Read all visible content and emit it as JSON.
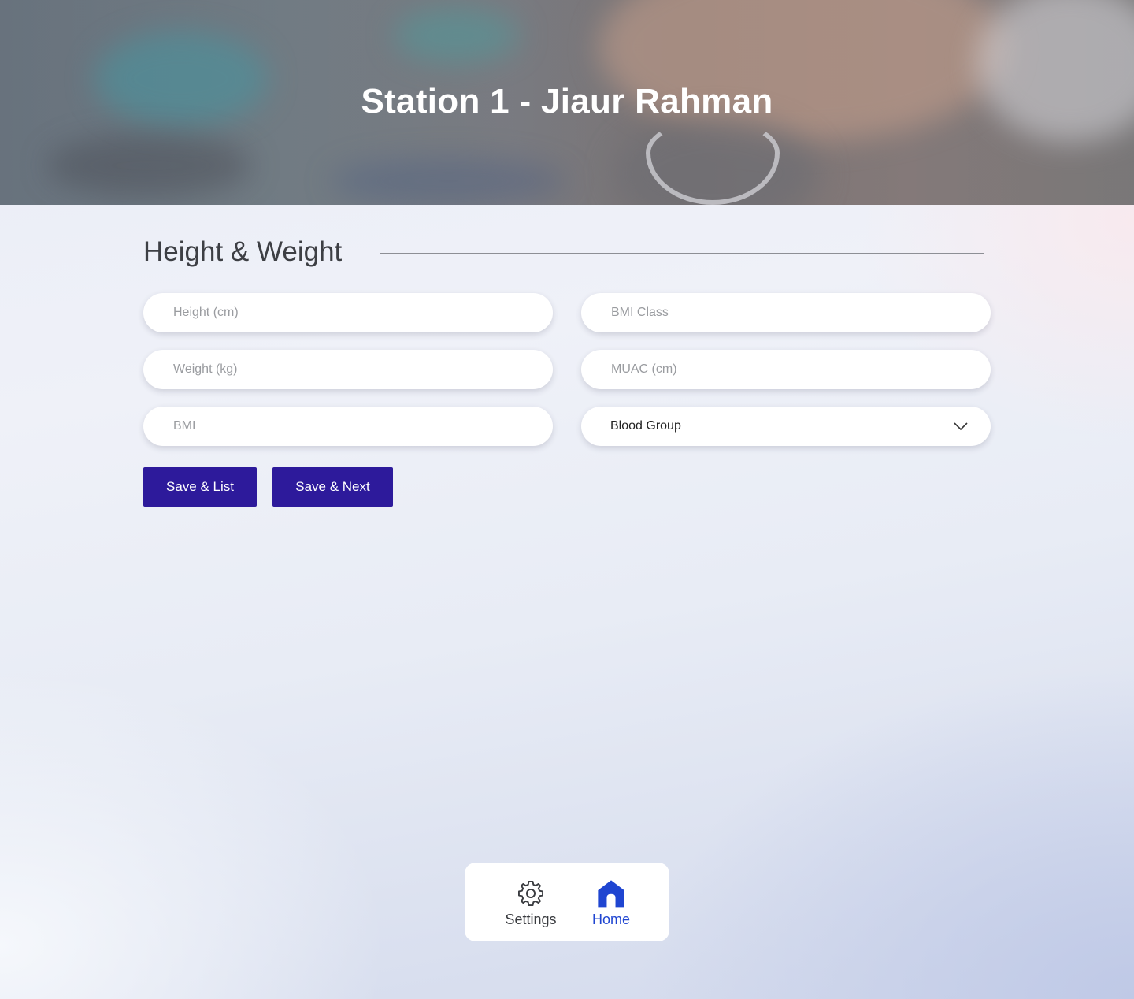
{
  "header": {
    "title": "Station 1 - Jiaur Rahman"
  },
  "section": {
    "title": "Height & Weight"
  },
  "fields": {
    "height": {
      "placeholder": "Height (cm)",
      "value": ""
    },
    "weight": {
      "placeholder": "Weight (kg)",
      "value": ""
    },
    "bmi": {
      "placeholder": "BMI",
      "value": ""
    },
    "bmi_class": {
      "placeholder": "BMI Class",
      "value": ""
    },
    "muac": {
      "placeholder": "MUAC (cm)",
      "value": ""
    },
    "blood_group": {
      "selected": "Blood Group"
    }
  },
  "actions": {
    "save_list": "Save & List",
    "save_next": "Save & Next"
  },
  "nav": {
    "settings": {
      "label": "Settings",
      "icon": "gear-icon"
    },
    "home": {
      "label": "Home",
      "icon": "home-icon",
      "active": true
    }
  },
  "colors": {
    "primary_button": "#2d1a9b",
    "active_nav": "#1f45d1",
    "title_text": "#3d3f44"
  }
}
